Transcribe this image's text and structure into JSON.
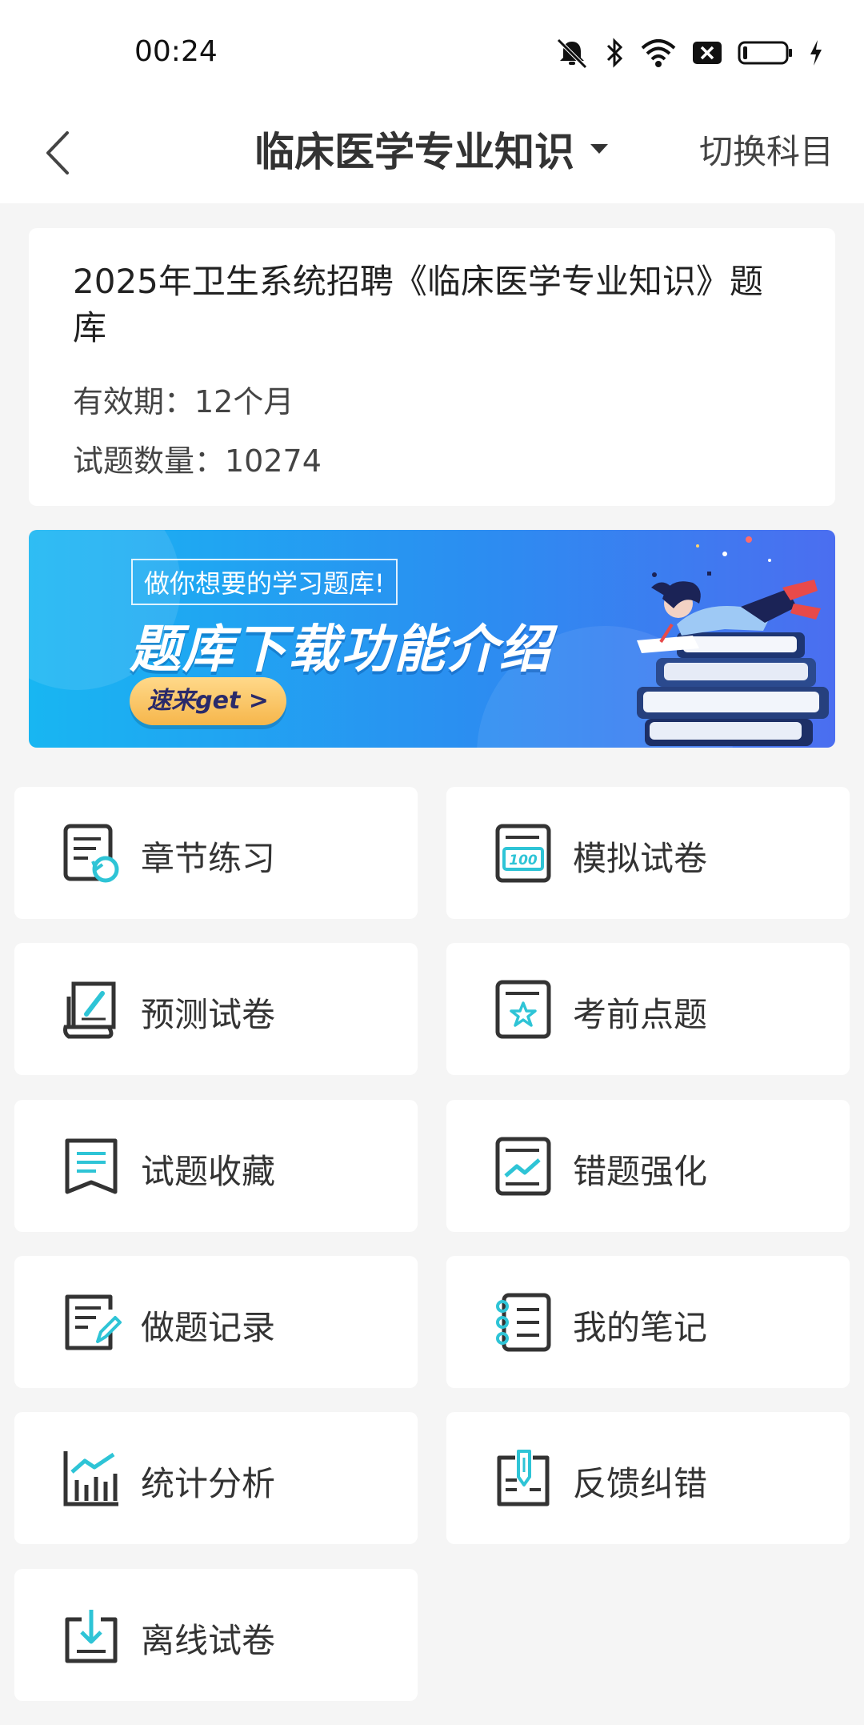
{
  "status_bar": {
    "time": "00:24"
  },
  "nav": {
    "title": "临床医学专业知识",
    "switch_label": "切换科目"
  },
  "info": {
    "title": "2025年卫生系统招聘《临床医学专业知识》题库",
    "validity": "有效期：12个月",
    "question_count": "试题数量：10274"
  },
  "banner": {
    "subtitle": "做你想要的学习题库!",
    "headline": "题库下载功能介绍",
    "button_label": "速来get >"
  },
  "features": [
    {
      "label": "章节练习",
      "icon": "chapter-practice-icon"
    },
    {
      "label": "模拟试卷",
      "icon": "mock-exam-icon"
    },
    {
      "label": "预测试卷",
      "icon": "predict-exam-icon"
    },
    {
      "label": "考前点题",
      "icon": "key-points-icon"
    },
    {
      "label": "试题收藏",
      "icon": "bookmark-icon"
    },
    {
      "label": "错题强化",
      "icon": "mistake-review-icon"
    },
    {
      "label": "做题记录",
      "icon": "practice-record-icon"
    },
    {
      "label": "我的笔记",
      "icon": "notes-icon"
    },
    {
      "label": "统计分析",
      "icon": "statistics-icon"
    },
    {
      "label": "反馈纠错",
      "icon": "feedback-icon"
    },
    {
      "label": "离线试卷",
      "icon": "offline-download-icon"
    }
  ],
  "colors": {
    "accent": "#2ec4d6",
    "icon_dark": "#333333",
    "background": "#f5f5f5"
  }
}
